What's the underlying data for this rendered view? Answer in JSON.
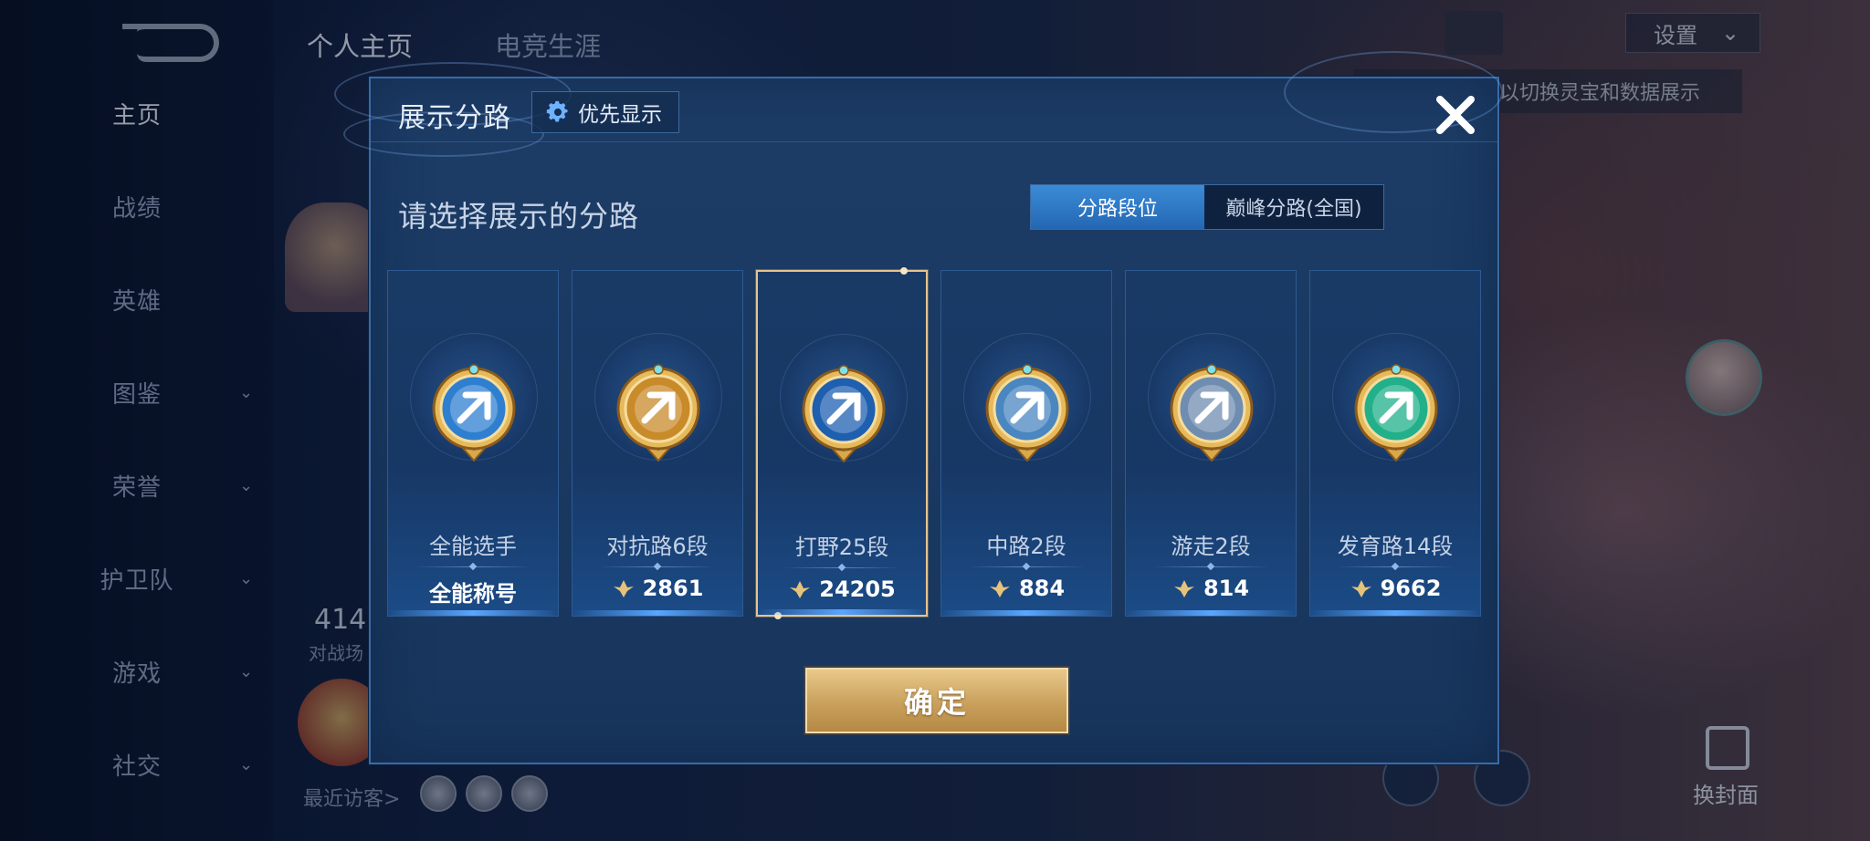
{
  "background": {
    "nav_items": [
      {
        "label": "主页",
        "active": true,
        "has_chevron": false
      },
      {
        "label": "战绩",
        "active": false,
        "has_chevron": false
      },
      {
        "label": "英雄",
        "active": false,
        "has_chevron": false
      },
      {
        "label": "图鉴",
        "active": false,
        "has_chevron": true
      },
      {
        "label": "荣誉",
        "active": false,
        "has_chevron": true
      },
      {
        "label": "护卫队",
        "active": false,
        "has_chevron": true
      },
      {
        "label": "游戏",
        "active": false,
        "has_chevron": true
      },
      {
        "label": "社交",
        "active": false,
        "has_chevron": true
      }
    ],
    "top_tabs": [
      {
        "label": "个人主页",
        "active": true
      },
      {
        "label": "电竞生涯",
        "active": false
      }
    ],
    "settings_label": "设置",
    "hint_text": "以切换灵宝和数据展示",
    "stat_value": "414",
    "stat_label": "对战场",
    "recent_visitors_label": "最近访客>",
    "switch_cover_label": "换封面"
  },
  "modal": {
    "title": "展示分路",
    "priority_button_label": "优先显示",
    "subtitle": "请选择展示的分路",
    "toggle": [
      {
        "label": "分路段位",
        "active": true
      },
      {
        "label": "巅峰分路(全国)",
        "active": false
      }
    ],
    "cards": [
      {
        "rank": "全能选手",
        "value": "全能称号",
        "show_icon": false,
        "selected": false,
        "emblem": "all-round-emblem",
        "color": "#2f7fd0"
      },
      {
        "rank": "对抗路6段",
        "value": "2861",
        "show_icon": true,
        "selected": false,
        "emblem": "clash-lane-emblem",
        "color": "#c98a2a"
      },
      {
        "rank": "打野25段",
        "value": "24205",
        "show_icon": true,
        "selected": true,
        "emblem": "jungle-emblem",
        "color": "#1f5fb0"
      },
      {
        "rank": "中路2段",
        "value": "884",
        "show_icon": true,
        "selected": false,
        "emblem": "mid-lane-emblem",
        "color": "#4a86c0"
      },
      {
        "rank": "游走2段",
        "value": "814",
        "show_icon": true,
        "selected": false,
        "emblem": "roam-emblem",
        "color": "#6f8db0"
      },
      {
        "rank": "发育路14段",
        "value": "9662",
        "show_icon": true,
        "selected": false,
        "emblem": "farm-lane-emblem",
        "color": "#21b08a"
      }
    ],
    "confirm_label": "确定",
    "colors": {
      "accent_gold": "#e9c98a",
      "toggle_active": "#2f7fd0",
      "panel": "#1a3a63"
    }
  }
}
